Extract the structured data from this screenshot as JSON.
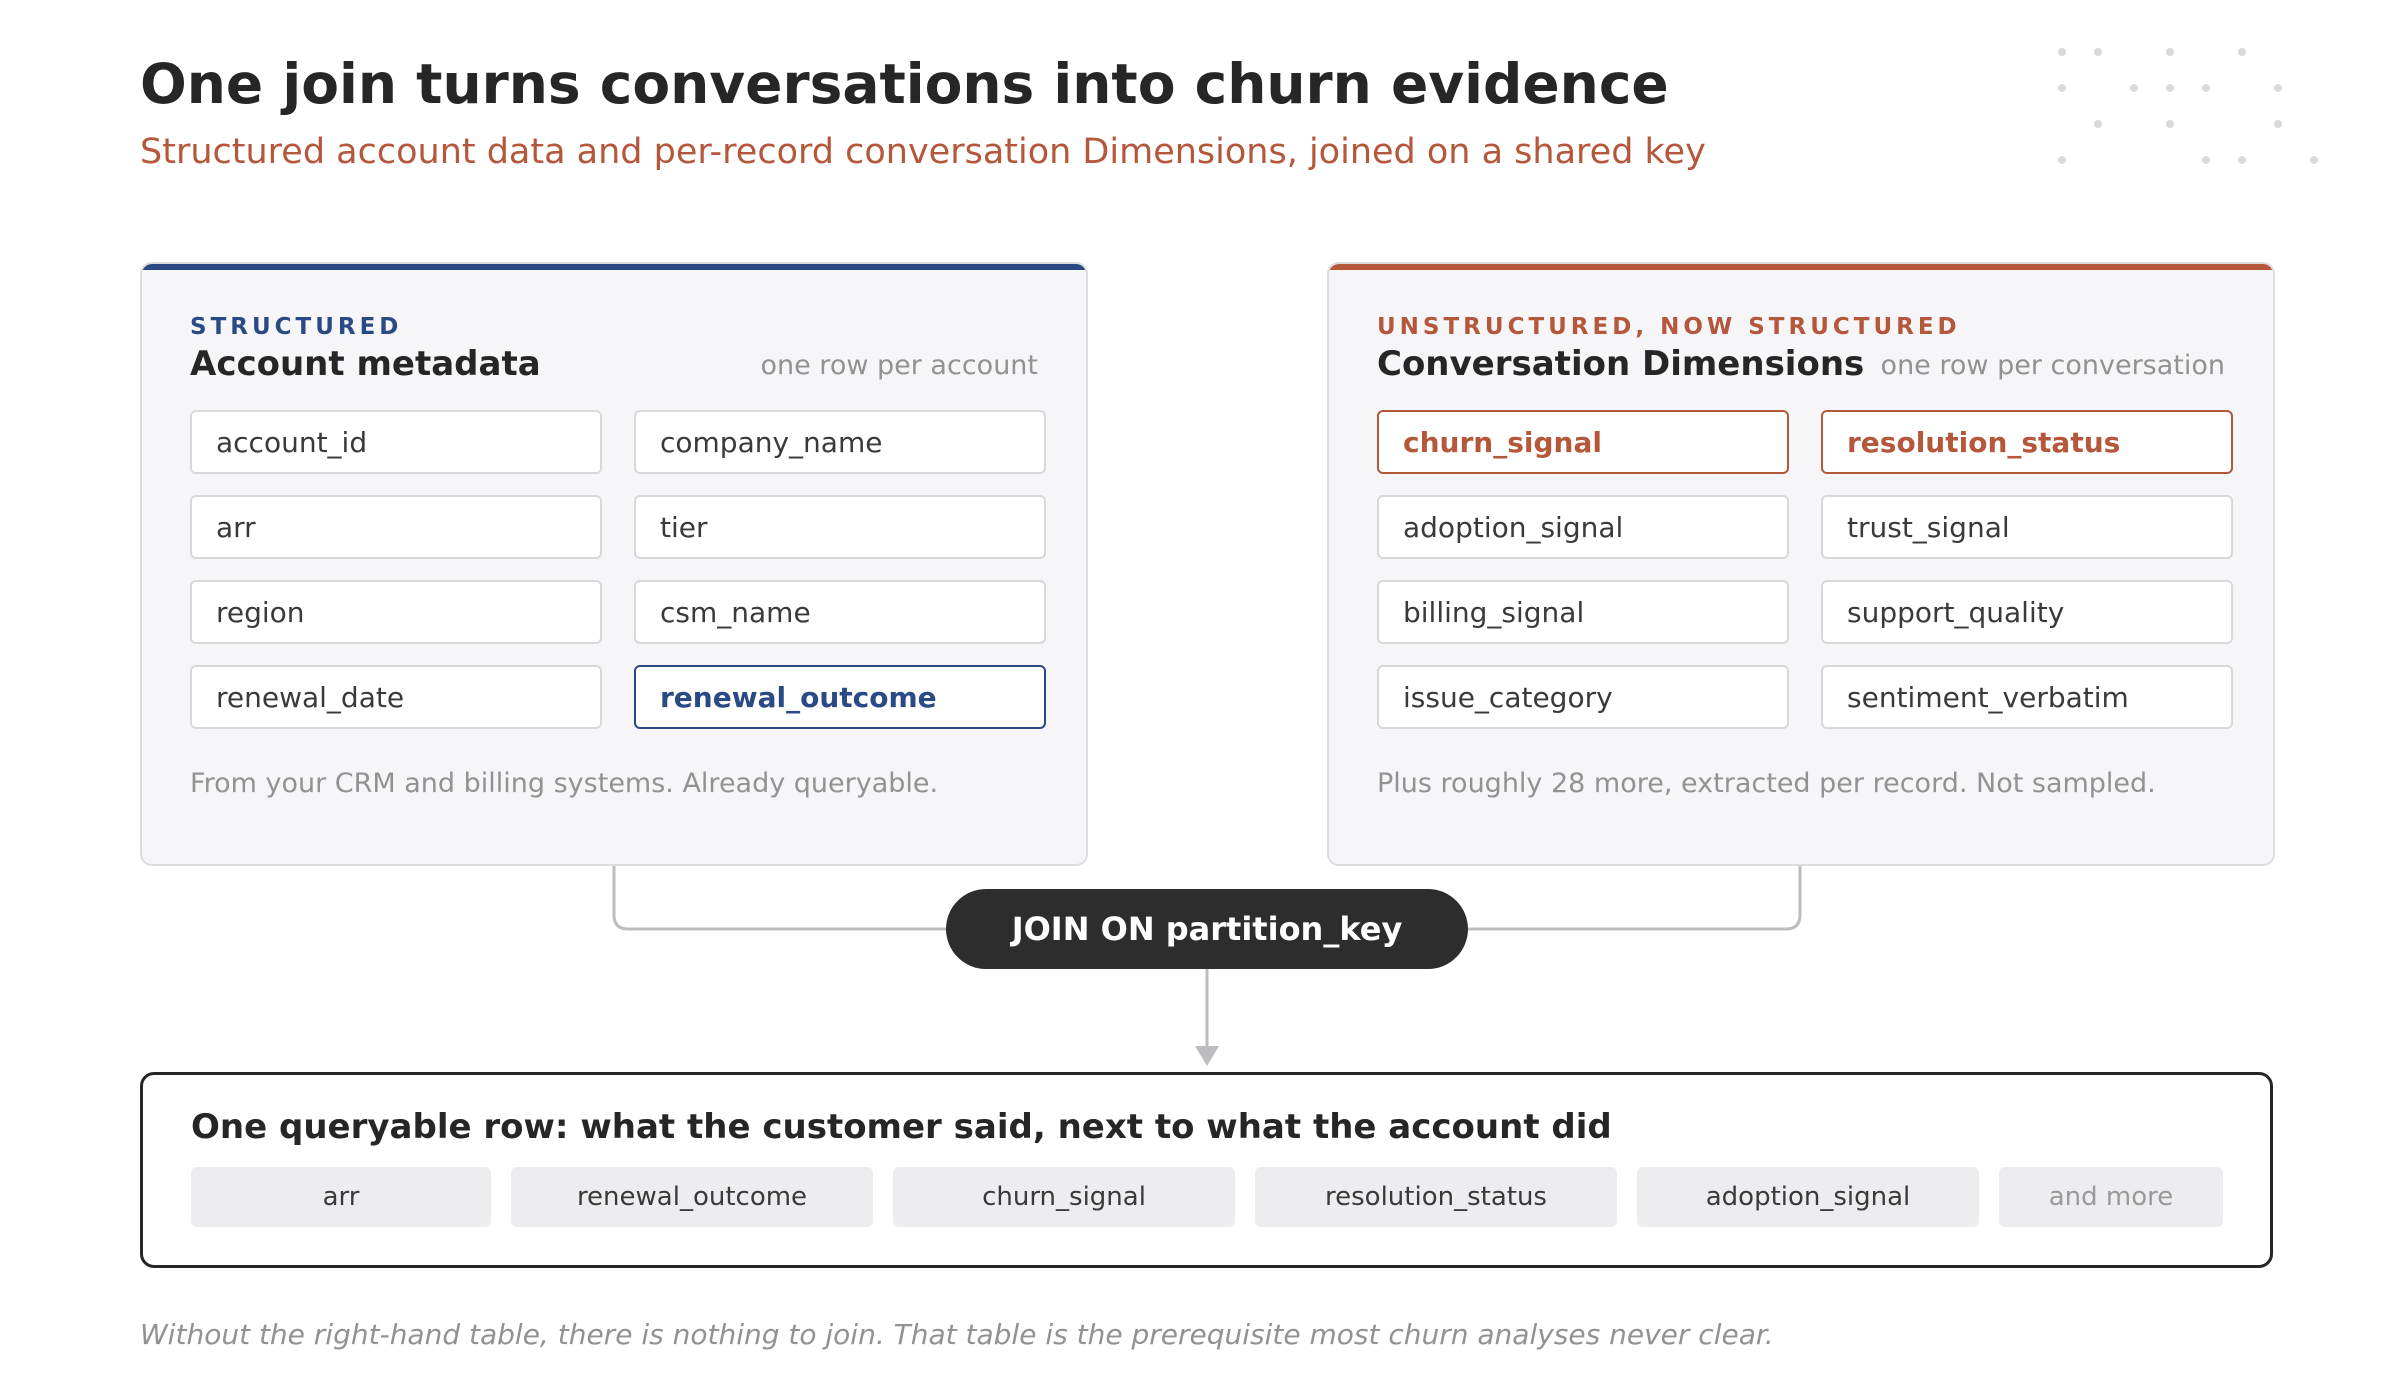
{
  "header": {
    "title": "One join turns conversations into churn evidence",
    "subtitle": "Structured account data and per-record conversation Dimensions, joined on a shared key"
  },
  "left_card": {
    "eyebrow": "STRUCTURED",
    "title": "Account metadata",
    "note": "one row per account",
    "fields": [
      "account_id",
      "company_name",
      "arr",
      "tier",
      "region",
      "csm_name",
      "renewal_date",
      "renewal_outcome"
    ],
    "highlighted_field": "renewal_outcome",
    "footer": "From your CRM and billing systems. Already queryable."
  },
  "right_card": {
    "eyebrow": "UNSTRUCTURED, NOW STRUCTURED",
    "title": "Conversation Dimensions",
    "note": "one row per conversation",
    "fields": [
      "churn_signal",
      "resolution_status",
      "adoption_signal",
      "trust_signal",
      "billing_signal",
      "support_quality",
      "issue_category",
      "sentiment_verbatim"
    ],
    "highlighted_fields": [
      "churn_signal",
      "resolution_status"
    ],
    "footer": "Plus roughly 28 more, extracted per record. Not sampled."
  },
  "join": {
    "label": "JOIN ON partition_key"
  },
  "result": {
    "title": "One queryable row: what the customer said, next to what the account did",
    "chips": [
      "arr",
      "renewal_outcome",
      "churn_signal",
      "resolution_status",
      "adoption_signal",
      "and more"
    ]
  },
  "footnote": "Without the right-hand table, there is nothing to join. That table is the prerequisite most churn analyses never clear.",
  "colors": {
    "structured_accent": "#2a4a85",
    "unstructured_accent": "#b4573a",
    "text": "#262626",
    "muted": "#929292"
  }
}
